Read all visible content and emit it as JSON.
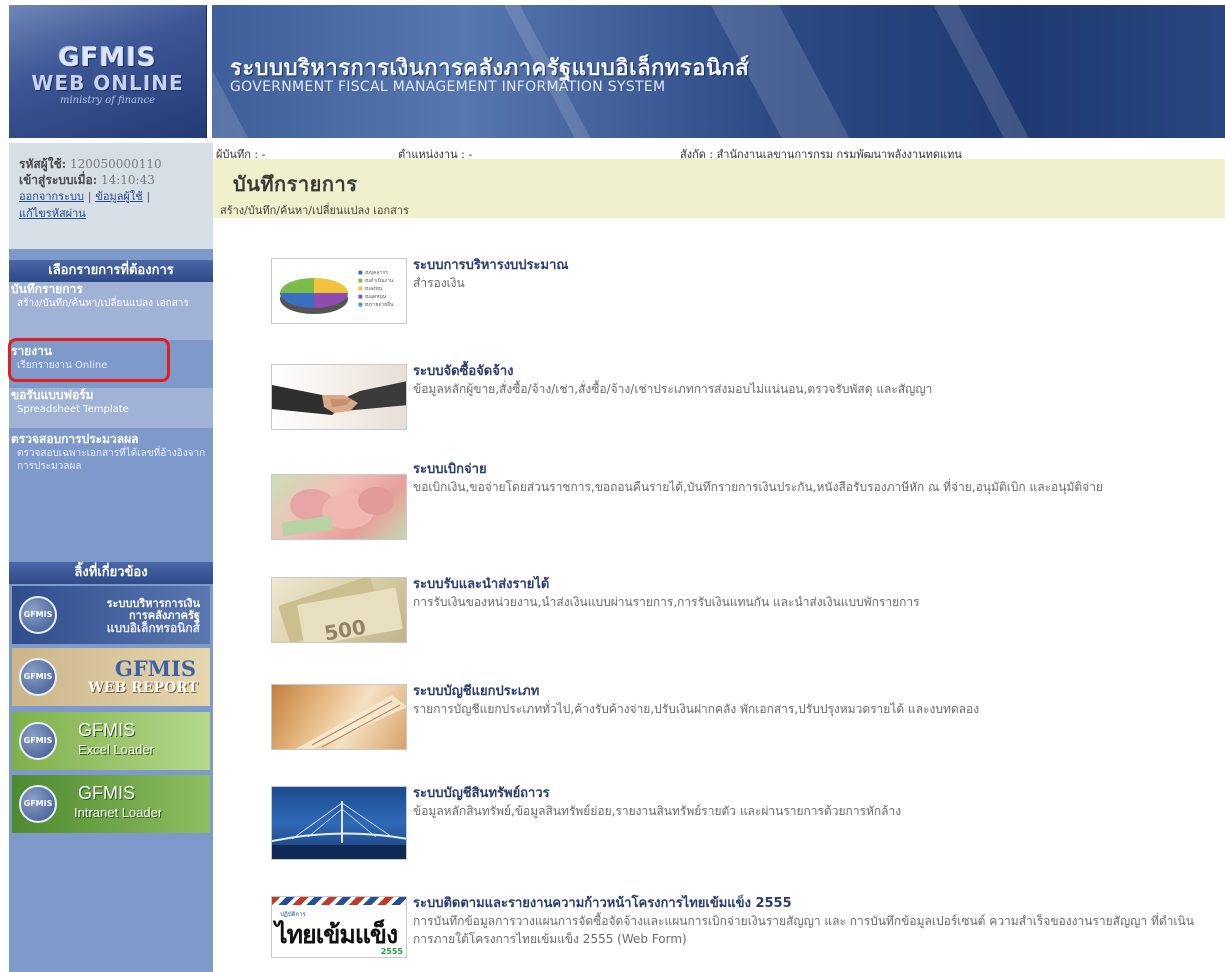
{
  "header": {
    "logo_line1": "GFMIS",
    "logo_line2": "WEB ONLINE",
    "logo_line3": "ministry of finance",
    "title_th": "ระบบบริหารการเงินการคลังภาครัฐแบบอิเล็กทรอนิกส์",
    "title_en": "GOVERNMENT FISCAL MANAGEMENT INFORMATION SYSTEM"
  },
  "user": {
    "id_label": "รหัสผู้ใช้:",
    "id_value": "120050000110",
    "login_label": "เข้าสู่ระบบเมื่อ:",
    "login_value": "14:10:43",
    "logout_link": "ออกจากระบบ",
    "userinfo_link": "ข้อมูลผู้ใช้",
    "changepw_link": "แก้ไขรหัสผ่าน",
    "separator": "|"
  },
  "sidebar": {
    "menu_header": "เลือกรายการที่ต้องการ",
    "items": [
      {
        "title": "บันทึกรายการ",
        "sub": "สร้าง/บันทึก/ค้นหา/เปลี่ยนแปลง เอกสาร"
      },
      {
        "title": "รายงาน",
        "sub": "เรียกรายงาน Online"
      },
      {
        "title": "ขอรับแบบฟอร์ม",
        "sub": "Spreadsheet Template"
      },
      {
        "title": "ตรวจสอบการประมวลผล",
        "sub": "ตรวจสอบเฉพาะเอกสารที่ได้เลขที่อ้างอิงจากการประมวลผล"
      }
    ],
    "links_header": "ลิ้งที่เกี่ยวข้อง",
    "links": [
      {
        "logo": "GFMIS",
        "line1": "ระบบบริหารการเงิน",
        "line2": "การคลังภาครัฐ",
        "line3": "แบบอิเล็กทรอนิกส์"
      },
      {
        "logo": "GFMIS",
        "line1": "GFMIS",
        "line2": "WEB REPORT"
      },
      {
        "logo": "GFMIS",
        "line1": "GFMIS",
        "line2": "Excel Loader"
      },
      {
        "logo": "GFMIS",
        "line1": "GFMIS",
        "line2": "Intranet Loader"
      }
    ]
  },
  "info_bar": {
    "recorder": "ผู้บันทึก : -",
    "position": "ตำแหน่งงาน : -",
    "affiliation": "สังกัด : สำนักงานเลขานุการกรม กรมพัฒนาพลังงานทดแทน"
  },
  "page": {
    "title": "บันทึกรายการ",
    "subtitle": "สร้าง/บันทึก/ค้นหา/เปลี่ยนแปลง เอกสาร"
  },
  "modules": [
    {
      "title": "ระบบการบริหารงบประมาณ",
      "desc": "สำรองเงิน"
    },
    {
      "title": "ระบบจัดซื้อจัดจ้าง",
      "desc": "ข้อมูลหลักผู้ขาย,สั่งซื้อ/จ้าง/เช่า,สั่งซื้อ/จ้าง/เช่าประเภทการส่งมอบไม่แน่นอน,ตรวจรับพัสดุ และสัญญา"
    },
    {
      "title": "ระบบเบิกจ่าย",
      "desc": "ขอเบิกเงิน,ขอจ่ายโดยส่วนราชการ,ขอถอนคืนรายได้,บันทึกรายการเงินประกัน,หนังสือรับรองภาษีหัก ณ ที่จ่าย,อนุมัติเบิก และอนุมัติจ่าย"
    },
    {
      "title": "ระบบรับและนำส่งรายได้",
      "desc": "การรับเงินของหน่วยงาน,นำส่งเงินแบบผ่านรายการ,การรับเงินแทนกัน และนำส่งเงินแบบพักรายการ"
    },
    {
      "title": "ระบบบัญชีแยกประเภท",
      "desc": "รายการบัญชีแยกประเภททั่วไป,ค้างรับค้างจ่าย,ปรับเงินฝากคลัง พักเอกสาร,ปรับปรุงหมวดรายได้ และงบทดลอง"
    },
    {
      "title": "ระบบบัญชีสินทรัพย์ถาวร",
      "desc": "ข้อมูลหลักสินทรัพย์,ข้อมูลสินทรัพย์ย่อย,รายงานสินทรัพย์รายตัว และผ่านรายการด้วยการหักล้าง"
    },
    {
      "title": "ระบบติดตามและรายงานความก้าวหน้าโครงการไทยเข้มแข็ง 2555",
      "desc": "การบันทึกข้อมูลการวางแผนการจัดซื้อจัดจ้างและแผนการเบิกจ่ายเงินรายสัญญา และ การบันทึกข้อมูลเปอร์เซนต์ ความสำเร็จของงานรายสัญญา ที่ดำเนินการภายใต้โครงการไทยเข้มแข็ง 2555 (Web Form)"
    }
  ],
  "thumb7": {
    "top": "ปฏิบัติการ",
    "main": "ไทยเข้มแข็ง",
    "year": "2555"
  },
  "pie_legend": [
    "งบบุคลากร",
    "งบดำเนินงาน",
    "งบลงทุน",
    "งบอุดหนุน",
    "งบรายจ่ายอื่น"
  ],
  "colors": {
    "sidebar": "#7d9acb",
    "title_bg": "#f0f1cc",
    "highlight": "#e02020"
  }
}
